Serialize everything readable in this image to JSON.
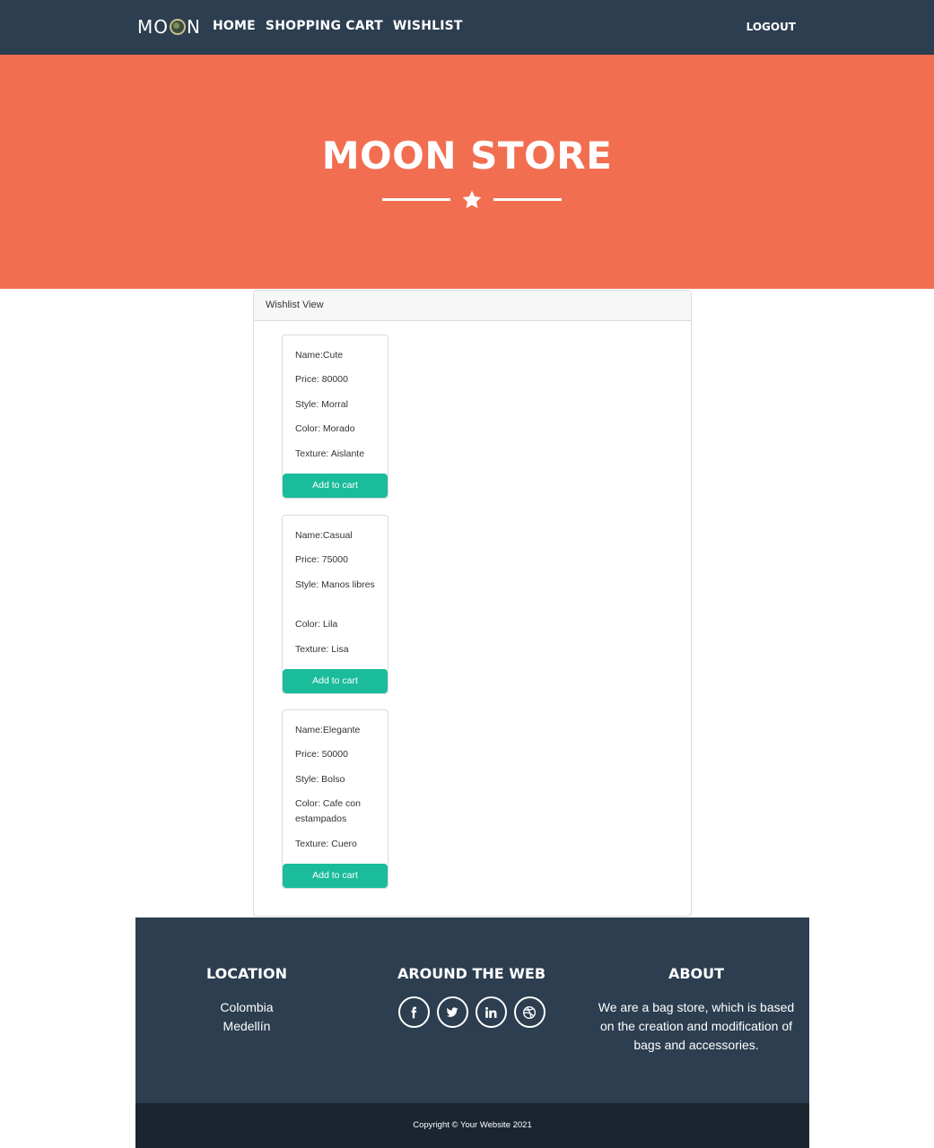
{
  "navbar": {
    "brand": {
      "pre": "MO",
      "post": "N"
    },
    "links": [
      "Home",
      "Shopping Cart",
      "Wishlist"
    ],
    "logout": "Logout"
  },
  "hero": {
    "title": "MOON STORE"
  },
  "wishlist": {
    "header": "Wishlist View",
    "items": [
      {
        "name": "Name:Cute",
        "price": "Price: 80000",
        "style": "Style: Morral",
        "color": "Color: Morado",
        "texture": "Texture: Aislante",
        "button": "Add to cart"
      },
      {
        "name": "Name:Casual",
        "price": "Price: 75000",
        "style": "Style: Manos libres",
        "color": "Color: Lila",
        "texture": "Texture: Lisa",
        "button": "Add to cart"
      },
      {
        "name": "Name:Elegante",
        "price": "Price: 50000",
        "style": "Style: Bolso",
        "color": "Color: Cafe con estampados",
        "texture": "Texture: Cuero",
        "button": "Add to cart"
      }
    ]
  },
  "footer": {
    "location": {
      "title": "Location",
      "line1": "Colombia",
      "line2": "Medellín"
    },
    "web": {
      "title": "Around the Web",
      "icons": [
        "facebook-icon",
        "twitter-icon",
        "linkedin-icon",
        "dribbble-icon"
      ]
    },
    "about": {
      "title": "About",
      "text": "We are a bag store, which is based on the creation and modification of bags and accessories."
    },
    "copyright": "Copyright © Your Website 2021"
  }
}
